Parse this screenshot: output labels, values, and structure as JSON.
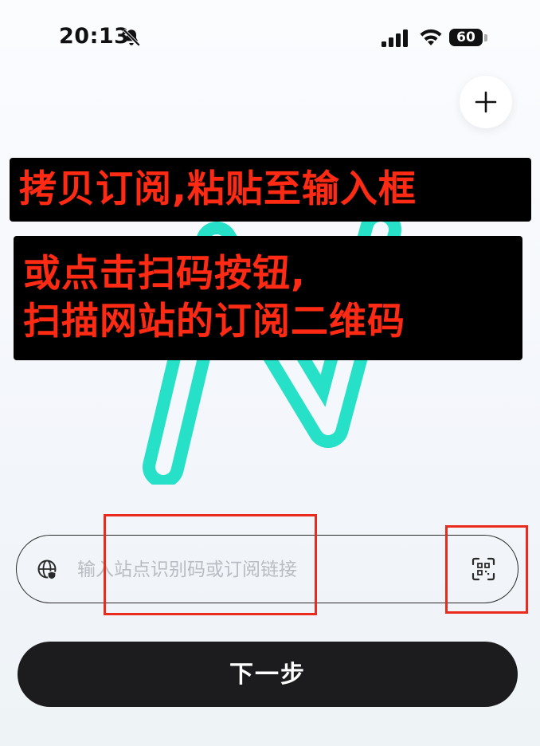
{
  "status_bar": {
    "time": "20:13",
    "battery": "60",
    "icons": [
      "bell-slash-icon",
      "cellular-signal-icon",
      "wifi-icon",
      "battery-icon"
    ]
  },
  "header": {
    "add_icon": "plus-icon"
  },
  "overlay": {
    "line1": "拷贝订阅,粘贴至输入框",
    "line2": "或点击扫码按钮,",
    "line3": "扫描网站的订阅二维码",
    "text_color": "#ff2a14",
    "bg_color": "#000000"
  },
  "logo": {
    "color": "#27e0c8"
  },
  "form": {
    "placeholder": "输入站点识别码或订阅链接",
    "value": "",
    "globe_icon": "globe-shield-icon",
    "scan_icon": "qr-scan-icon"
  },
  "annotations": {
    "color": "#ea2a1a"
  },
  "next_button": {
    "label": "下一步"
  }
}
